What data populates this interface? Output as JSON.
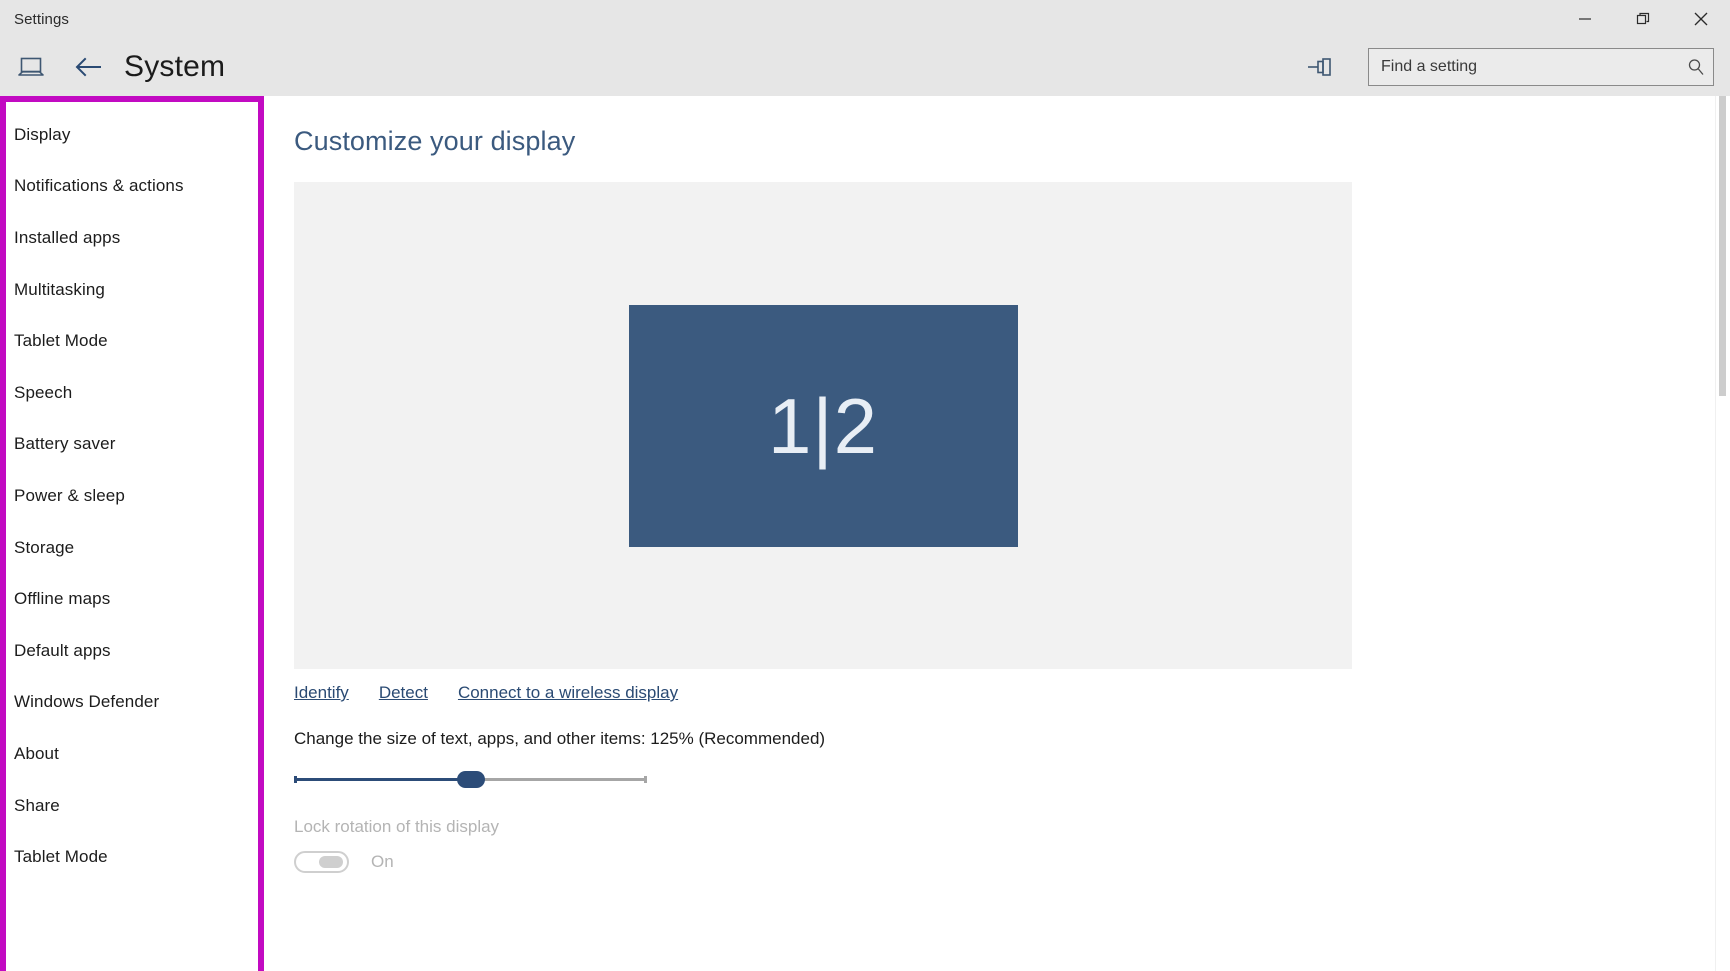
{
  "window": {
    "title": "Settings",
    "controls": {
      "minimize": "minimize-icon",
      "maximize": "restore-icon",
      "close": "close-icon"
    }
  },
  "header": {
    "device_icon": "laptop-icon",
    "back_icon": "back-arrow-icon",
    "title": "System",
    "pin_icon": "pin-icon",
    "search": {
      "value": "",
      "placeholder": "Find a setting",
      "icon": "search-icon"
    }
  },
  "sidebar": {
    "highlight_color": "#c20ac2",
    "items": [
      {
        "label": "Display"
      },
      {
        "label": "Notifications & actions"
      },
      {
        "label": "Installed apps"
      },
      {
        "label": "Multitasking"
      },
      {
        "label": "Tablet Mode"
      },
      {
        "label": "Speech"
      },
      {
        "label": "Battery saver"
      },
      {
        "label": "Power & sleep"
      },
      {
        "label": "Storage"
      },
      {
        "label": "Offline maps"
      },
      {
        "label": "Default apps"
      },
      {
        "label": "Windows Defender"
      },
      {
        "label": "About"
      },
      {
        "label": "Share"
      },
      {
        "label": "Tablet Mode"
      }
    ]
  },
  "main": {
    "title": "Customize your display",
    "monitor": {
      "label": "1|2",
      "color": "#3b5a7f"
    },
    "links": [
      {
        "label": "Identify"
      },
      {
        "label": "Detect"
      },
      {
        "label": "Connect to a wireless display"
      }
    ],
    "scale": {
      "label": "Change the size of text, apps, and other items: 125% (Recommended)",
      "value": "125%",
      "fill_percent": 50
    },
    "lock_rotation": {
      "label": "Lock rotation of this display",
      "state": "On"
    }
  }
}
